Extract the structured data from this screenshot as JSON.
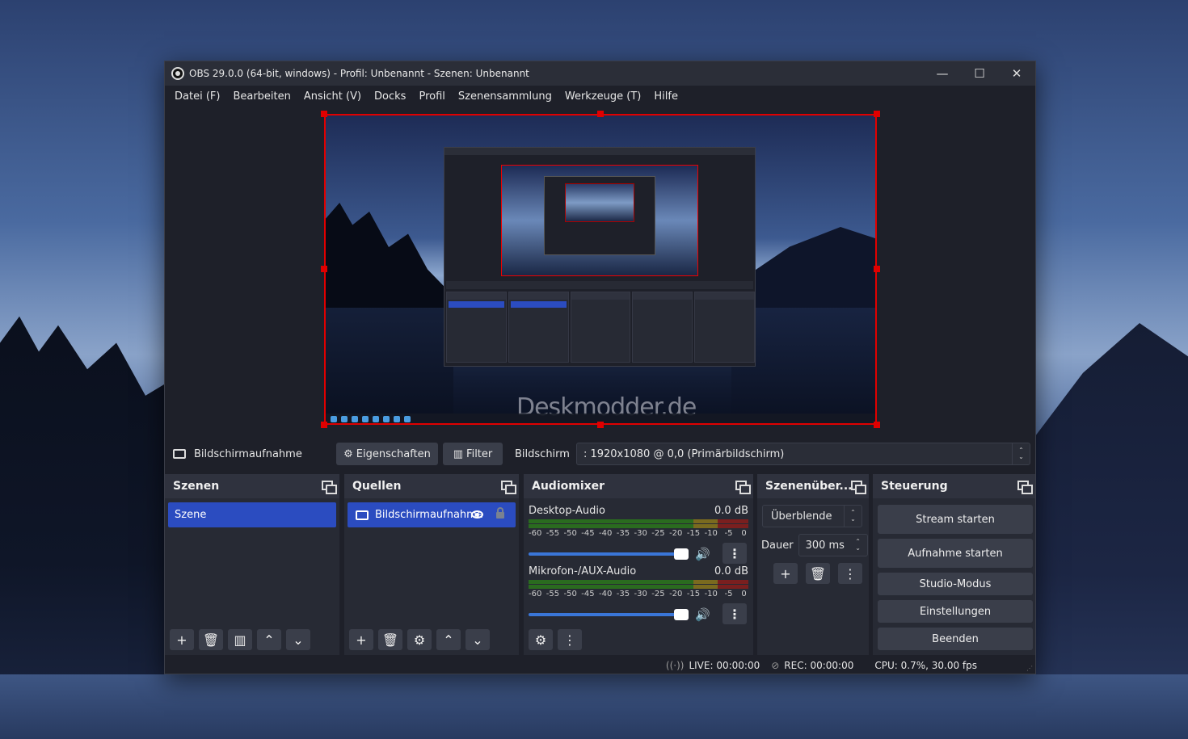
{
  "window": {
    "title": "OBS 29.0.0 (64-bit, windows) - Profil: Unbenannt - Szenen: Unbenannt",
    "controls": {
      "minimize": "—",
      "maximize": "☐",
      "close": "✕"
    }
  },
  "menu": [
    "Datei (F)",
    "Bearbeiten",
    "Ansicht (V)",
    "Docks",
    "Profil",
    "Szenensammlung",
    "Werkzeuge (T)",
    "Hilfe"
  ],
  "preview": {
    "watermark": "Deskmodder.de"
  },
  "source_bar": {
    "source_name": "Bildschirmaufnahme",
    "properties_label": "Eigenschaften",
    "filter_label": "Filter",
    "display_label": "Bildschirm",
    "display_value": ": 1920x1080 @ 0,0 (Primärbildschirm)"
  },
  "scenes": {
    "title": "Szenen",
    "items": [
      "Szene"
    ]
  },
  "sources": {
    "title": "Quellen",
    "items": [
      "Bildschirmaufnahme"
    ]
  },
  "mixer": {
    "title": "Audiomixer",
    "scale": [
      "-60",
      "-55",
      "-50",
      "-45",
      "-40",
      "-35",
      "-30",
      "-25",
      "-20",
      "-15",
      "-10",
      "-5",
      "0"
    ],
    "channels": [
      {
        "name": "Desktop-Audio",
        "level": "0.0 dB",
        "volume_fraction": 1.0
      },
      {
        "name": "Mikrofon-/AUX-Audio",
        "level": "0.0 dB",
        "volume_fraction": 1.0
      }
    ]
  },
  "transitions": {
    "title": "Szenenüber...",
    "selected": "Überblende",
    "duration_label": "Dauer",
    "duration_value": "300 ms"
  },
  "controls": {
    "title": "Steuerung",
    "buttons": [
      "Stream starten",
      "Aufnahme starten",
      "Studio-Modus",
      "Einstellungen",
      "Beenden"
    ]
  },
  "status": {
    "live": "LIVE: 00:00:00",
    "rec": "REC: 00:00:00",
    "cpu": "CPU: 0.7%, 30.00 fps"
  }
}
